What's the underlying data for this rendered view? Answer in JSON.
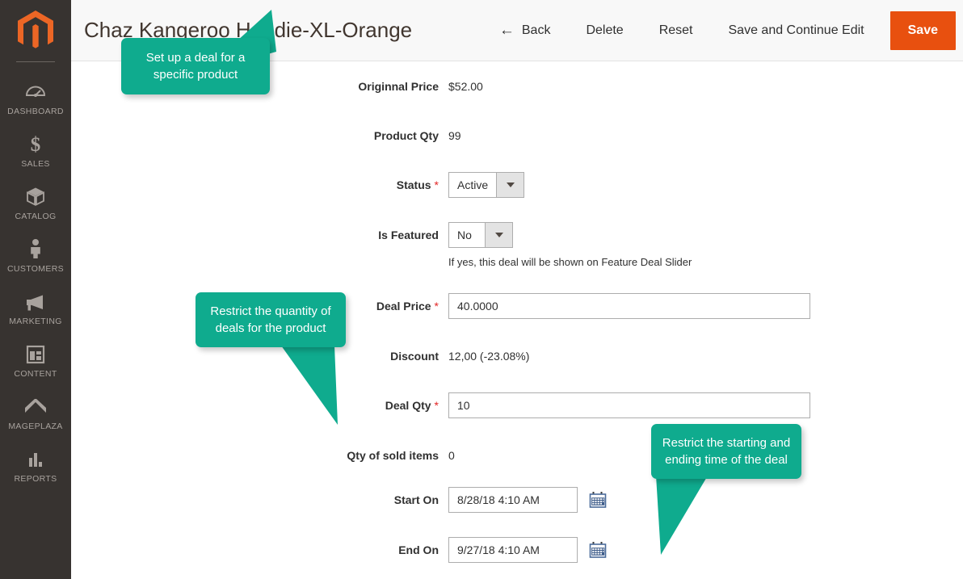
{
  "sidebar": {
    "logo_name": "magento-logo",
    "items": [
      {
        "label": "DASHBOARD",
        "icon": "dashboard-gauge-icon"
      },
      {
        "label": "SALES",
        "icon": "dollar-sign-icon"
      },
      {
        "label": "CATALOG",
        "icon": "box-icon"
      },
      {
        "label": "CUSTOMERS",
        "icon": "person-icon"
      },
      {
        "label": "MARKETING",
        "icon": "megaphone-icon"
      },
      {
        "label": "CONTENT",
        "icon": "layout-page-icon"
      },
      {
        "label": "MAGEPLAZA",
        "icon": "chevron-up-badge-icon"
      },
      {
        "label": "REPORTS",
        "icon": "bar-chart-icon"
      }
    ]
  },
  "header": {
    "title": "Chaz Kangeroo Hoodie-XL-Orange",
    "back_label": "Back",
    "back_arrow": "←",
    "delete_label": "Delete",
    "reset_label": "Reset",
    "save_continue_label": "Save and Continue Edit",
    "save_label": "Save",
    "save_color": "#e8500f"
  },
  "form": {
    "original_price": {
      "label": "Originnal Price",
      "value": "$52.00"
    },
    "product_qty": {
      "label": "Product Qty",
      "value": "99"
    },
    "status": {
      "label": "Status",
      "required": "*",
      "value": "Active"
    },
    "is_featured": {
      "label": "Is Featured",
      "value": "No",
      "note": "If yes, this deal will be shown on Feature Deal Slider"
    },
    "deal_price": {
      "label": "Deal Price",
      "required": "*",
      "value": "40.0000"
    },
    "discount": {
      "label": "Discount",
      "value": "12,00 (-23.08%)"
    },
    "deal_qty": {
      "label": "Deal Qty",
      "required": "*",
      "value": "10"
    },
    "qty_sold": {
      "label": "Qty of sold items",
      "value": "0"
    },
    "start_on": {
      "label": "Start On",
      "value": "8/28/18 4:10 AM",
      "calendar_icon": "calendar-icon"
    },
    "end_on": {
      "label": "End On",
      "value": "9/27/18 4:10 AM",
      "calendar_icon": "calendar-icon"
    }
  },
  "callouts": {
    "color": "#0fab8e",
    "one": "Set up a deal for a specific product",
    "two": "Restrict the quantity of deals for the product",
    "three": "Restrict the starting and ending time of the deal"
  }
}
